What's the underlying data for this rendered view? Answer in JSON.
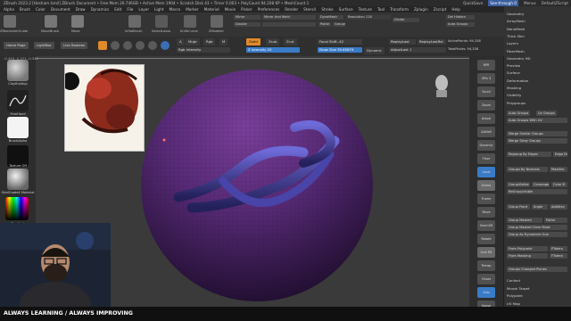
{
  "title_bar": {
    "title": "ZBrush 2023.2 [Hesham Ismil]   ZBrush Document   • Free Mem 26.746GB • Active Mem 1904 • Scratch Disk 43 • Timer 0.003 • PolyCount 94.208 KP • MeshCount 1",
    "quicksave": "QuickSave",
    "see_through": "See-through 0",
    "menus_label": "Menus",
    "script": "DefaultZScript"
  },
  "menu": [
    "Alpha",
    "Brush",
    "Color",
    "Document",
    "Draw",
    "Dynamics",
    "Edit",
    "File",
    "Layer",
    "Light",
    "Macro",
    "Marker",
    "Material",
    "Movie",
    "Picker",
    "Preferences",
    "Render",
    "Stencil",
    "Stroke",
    "Surface",
    "Texture",
    "Tool",
    "Transform",
    "Zplugin",
    "Zscript",
    "Help"
  ],
  "top_shelf": {
    "tools": [
      "ZRemesherGuide",
      "MoveBrush",
      "Move",
      "InflatBrush",
      "SelectLasso",
      "KnifeCurve",
      "ZModeler"
    ],
    "mirror": "Mirror",
    "mirror_weld": "Mirror And Weld",
    "double": "Double",
    "polish": "Polish",
    "groups": "Groups",
    "dynamesh": "DynaMesh",
    "resolution": "Resolution 128",
    "divide": "Divide",
    "del_hidden": "Del Hidden",
    "auto_groups": "Auto Groups"
  },
  "toolbar2": {
    "home_page": "Home Page",
    "lightbox": "LightBox",
    "live_boolean": "Live Boolean",
    "edit": "Edit",
    "draw": "Draw",
    "move": "Move",
    "scale": "Scale",
    "rotate": "Rotate",
    "a_label": "A",
    "mrgb": "Mrgb",
    "rgb": "Rgb",
    "m": "M",
    "zadd": "Zadd",
    "zsub": "Zsub",
    "zcut": "Zcut",
    "rgb_intensity": "Rgb Intensity",
    "z_intensity": "Z Intensity 20",
    "focal_shift": "Focal Shift -42",
    "draw_size": "Draw Size 30.65679",
    "dynamic": "Dynamic",
    "replay_last": "ReplayLast",
    "replay_last_rel": "ReplayLastRel",
    "adjust_last": "AdjustLast 1",
    "active_points": "ActivePoints: 94,338",
    "total_points": "TotalPoints: 94,338"
  },
  "coords": "-0.455,-0.471,-0.345",
  "left_shelf": {
    "brush": "ClayBuildup",
    "stroke": "FreeHand",
    "alpha": "BrushAlpha",
    "texture": "Texture Off",
    "material": "SkinShade4 Material",
    "gradient": "Gradient",
    "switch_color": "SwitchColor"
  },
  "right_shelf": [
    "BPR",
    "SPix 3",
    "Scroll",
    "Zoom",
    "Actual",
    "AAHalf",
    "Dynamic Persp",
    "Floor",
    "Local",
    "Gizmo",
    "Frame",
    "Move",
    "Zoom3D",
    "Rotate",
    "Line Fill PolyF",
    "Transp",
    "Ghost",
    "Solo",
    "Xpose"
  ],
  "right_panel": {
    "top_items": [
      "Geometry",
      "ArrayMesh",
      "NanoMesh",
      "Thick Skin",
      "Layers",
      "FiberMesh",
      "Geometry HD",
      "Preview",
      "Surface",
      "Deformation",
      "Masking",
      "Visibility",
      "Polygroups"
    ],
    "auto_groups": "Auto Groups",
    "uv_groups": "Uv Groups",
    "auto_groups_uv": "Auto Groups With UV",
    "merge_similar": "Merge Similar Groups",
    "merge_stray": "Merge Stray Groups",
    "regroup_edges": "Regroup By Edges",
    "edge_dist": "Edge Di",
    "groups_by_normals": "Groups By Normals",
    "max_dev": "MaxDev",
    "group_visible": "GroupVisible",
    "coverage": "Coverage",
    "color_b": "Color B",
    "regroup_visible": "ReGroupVisible",
    "group_front": "Group Front",
    "angle": "Angle",
    "additive": "Additive",
    "group_masked": "Group Masked",
    "polish": "Polish",
    "group_masked_clear": "Group Masked Clear Mask",
    "group_dynamesh": "Group As Dynamesh Sub",
    "from_polypaint": "From Polypaint",
    "pt_tolerance": "PTolera",
    "from_masking": "From Masking",
    "ft_tolerance": "FTolera",
    "group_changed": "Groups Changed Planes",
    "bottom_items": [
      "Contact",
      "Morph Target",
      "Polypaint",
      "UV Map"
    ]
  },
  "banner": "ALWAYS LEARNING  /  ALWAYS IMPROVING"
}
